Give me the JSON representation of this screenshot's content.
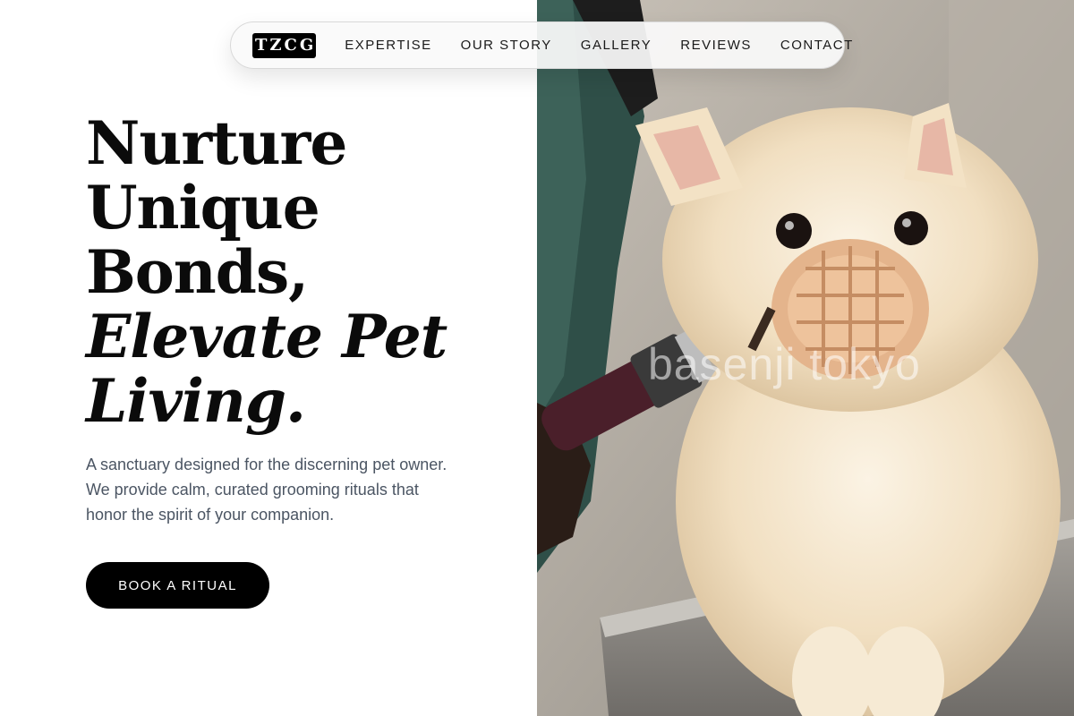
{
  "nav": {
    "logo": "TZCG",
    "links": [
      "EXPERTISE",
      "OUR STORY",
      "GALLERY",
      "REVIEWS",
      "CONTACT"
    ]
  },
  "hero": {
    "headline_lines": [
      "Nurture",
      "Unique",
      "Bonds,"
    ],
    "headline_italic_lines": [
      "Elevate Pet",
      "Living."
    ],
    "description": "A sanctuary designed for the discerning pet owner. We provide calm, curated grooming rituals that honor the spirit of your companion.",
    "cta_label": "BOOK A RITUAL"
  },
  "photo": {
    "watermark": "basenji tokyo"
  },
  "colors": {
    "accent": "#000000",
    "text": "#0b0b0b",
    "muted_text": "#4b5563",
    "background": "#ffffff"
  }
}
